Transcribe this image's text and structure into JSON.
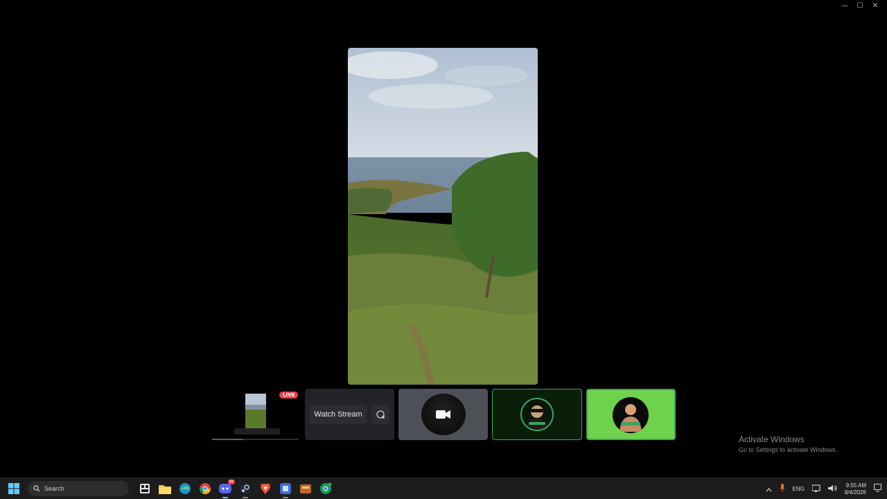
{
  "window": {
    "minimize": "—",
    "maximize": "☐",
    "close": "✕"
  },
  "stream": {
    "live_badge": "LIVE",
    "watch_label": "Watch Stream"
  },
  "system": {
    "activate_title": "Activate Windows",
    "activate_sub": "Go to Settings to activate Windows.",
    "search_placeholder": "Search",
    "lang": "ENG",
    "time": "9:55 AM",
    "date": "8/4/2026",
    "discord_badge": "99"
  },
  "colors": {
    "accent_green": "#3ba55d",
    "live_red": "#ed4245",
    "speaking_green": "#6fd24c"
  }
}
